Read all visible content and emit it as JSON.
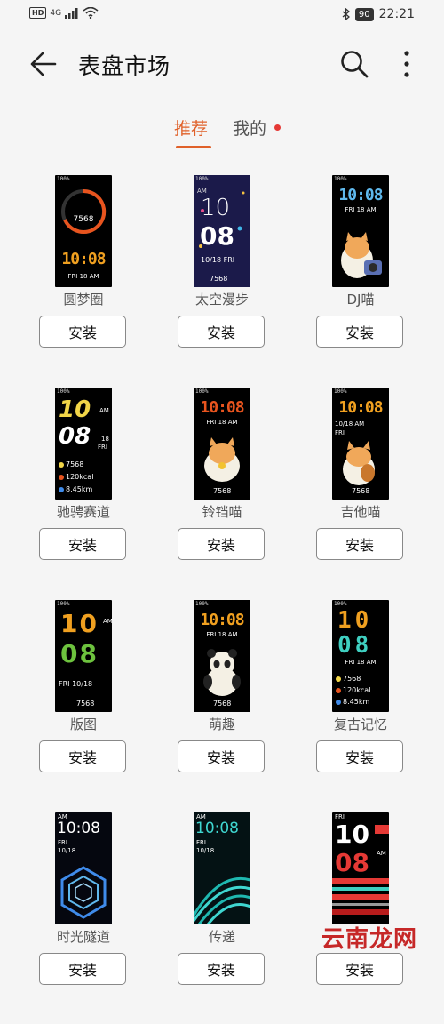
{
  "status_bar": {
    "left_badge": "HD",
    "network": "4G",
    "battery": "90",
    "time": "22:21",
    "icons": [
      "hd-icon",
      "signal-icon",
      "wifi-icon",
      "bluetooth-icon",
      "battery-icon"
    ]
  },
  "header": {
    "title": "表盘市场",
    "back_icon": "arrow-left-icon",
    "search_icon": "search-icon",
    "more_icon": "more-vertical-icon"
  },
  "tabs": [
    {
      "label": "推荐",
      "active": true
    },
    {
      "label": "我的",
      "active": false,
      "badge": "red-dot"
    }
  ],
  "colors": {
    "accent": "#e0612a",
    "badge": "#e53935"
  },
  "install_label": "安装",
  "faces": [
    {
      "name": "圆梦圈",
      "status": "100%",
      "steps": "7568",
      "time": "10:08",
      "date": "FRI 18 AM"
    },
    {
      "name": "太空漫步",
      "status": "100%",
      "ampm": "AM",
      "hour": "10",
      "minute": "08",
      "date": "10/18 FRI",
      "steps": "7568"
    },
    {
      "name": "DJ喵",
      "status": "100%",
      "time": "10:08",
      "date": "FRI 18 AM"
    },
    {
      "name": "驰骋赛道",
      "status": "100%",
      "hour": "10",
      "minute": "08",
      "ampm": "AM",
      "day": "18",
      "weekday": "FRI",
      "steps": "7568",
      "kcal": "120kcal",
      "km": "8.45km"
    },
    {
      "name": "铃铛喵",
      "status": "100%",
      "time": "10:08",
      "date": "FRI 18 AM",
      "steps": "7568"
    },
    {
      "name": "吉他喵",
      "status": "100%",
      "time": "10:08",
      "date": "10/18 AM",
      "weekday": "FRI",
      "steps": "7568"
    },
    {
      "name": "版图",
      "status": "100%",
      "hour": "10",
      "minute": "08",
      "ampm": "AM",
      "date": "FRI 10/18",
      "steps": "7568"
    },
    {
      "name": "萌趣",
      "status": "100%",
      "time": "10:08",
      "date": "FRI 18 AM",
      "steps": "7568"
    },
    {
      "name": "复古记忆",
      "status": "100%",
      "hour": "10",
      "minute": "08",
      "date": "FRI 18 AM",
      "steps": "7568",
      "kcal": "120kcal",
      "km": "8.45km"
    },
    {
      "name": "时光隧道",
      "ampm": "AM",
      "time": "10:08",
      "weekday": "FRI",
      "date": "10/18"
    },
    {
      "name": "传递",
      "ampm": "AM",
      "time": "10:08",
      "weekday": "FRI",
      "date": "10/18"
    },
    {
      "name": "",
      "weekday": "FRI",
      "hour": "10",
      "minute": "08",
      "ampm": "AM"
    }
  ],
  "watermark": "云南龙网"
}
